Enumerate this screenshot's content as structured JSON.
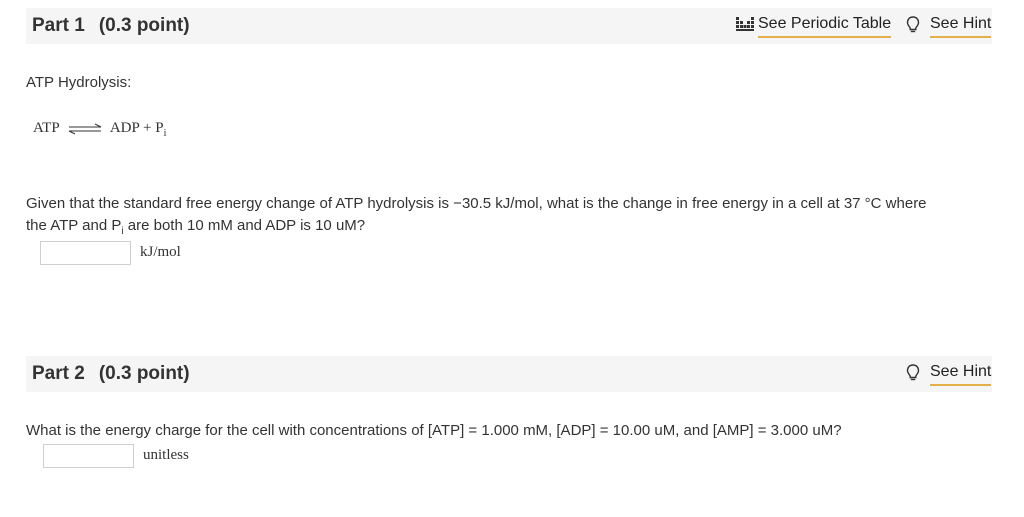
{
  "part1": {
    "title": "Part 1",
    "points": "(0.3 point)",
    "periodic_table_label": "See Periodic Table",
    "hint_label": "See Hint",
    "intro": "ATP Hydrolysis:",
    "equation": {
      "left": "ATP",
      "right": "ADP + P",
      "sub": "i"
    },
    "question_a": "Given that the standard free energy change of ATP hydrolysis is −30.5 kJ/mol, what is the change in free energy in a cell at 37 °C where",
    "question_b_pre": "the ATP and P",
    "question_b_sub": "i",
    "question_b_post": " are both 10 mM and ADP is 10 uM?",
    "answer_value": "",
    "unit": "kJ/mol"
  },
  "part2": {
    "title": "Part 2",
    "points": "(0.3 point)",
    "hint_label": "See Hint",
    "question": "What is the energy charge for the cell with concentrations of [ATP] = 1.000 mM, [ADP] = 10.00 uM, and [AMP] = 3.000 uM?",
    "answer_value": "",
    "unit": "unitless"
  },
  "colors": {
    "header_bg": "#f5f5f5",
    "link_underline": "#e3b04b"
  },
  "icons": {
    "periodic": "periodic-table-icon",
    "hint": "lightbulb-icon"
  }
}
